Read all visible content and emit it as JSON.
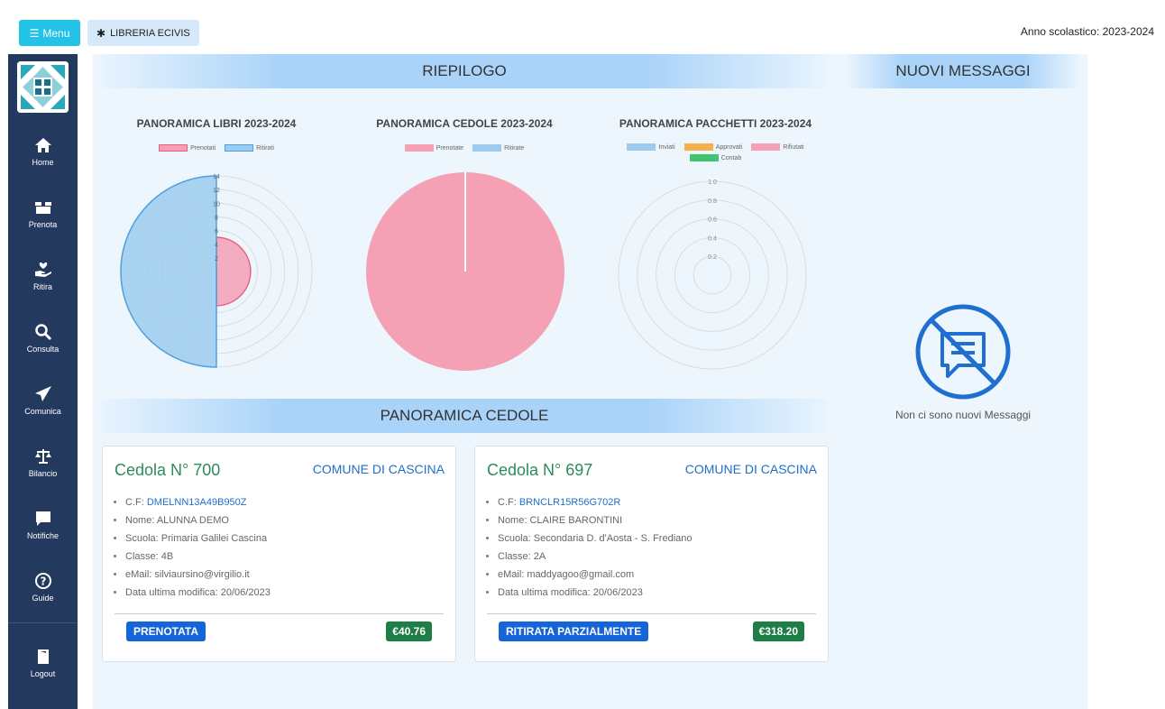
{
  "topbar": {
    "menu_label": "Menu",
    "library_label": "LIBRERIA ECIVIS",
    "school_year": "Anno scolastico: 2023-2024"
  },
  "sidebar": {
    "items": [
      {
        "label": "Home",
        "icon": "home-icon"
      },
      {
        "label": "Prenota",
        "icon": "box-icon"
      },
      {
        "label": "Ritira",
        "icon": "hand-icon"
      },
      {
        "label": "Consulta",
        "icon": "search-icon"
      },
      {
        "label": "Comunica",
        "icon": "paper-plane-icon"
      },
      {
        "label": "Bilancio",
        "icon": "scale-icon"
      },
      {
        "label": "Notifiche",
        "icon": "message-icon"
      },
      {
        "label": "Guide",
        "icon": "question-icon"
      },
      {
        "label": "Logout",
        "icon": "door-icon"
      }
    ]
  },
  "summary": {
    "title": "RIEPILOGO",
    "charts": [
      {
        "title": "PANORAMICA LIBRI 2023-2024",
        "legend": [
          {
            "label": "Prenotati",
            "color": "#f4a0b5"
          },
          {
            "label": "Ritirati",
            "color": "#9ccbef"
          }
        ],
        "ticks": [
          "14",
          "12",
          "10",
          "8",
          "6",
          "4",
          "2"
        ]
      },
      {
        "title": "PANORAMICA CEDOLE 2023-2024",
        "legend": [
          {
            "label": "Prenotate",
            "color": "#f4a0b5"
          },
          {
            "label": "Ritirate",
            "color": "#9ccbef"
          }
        ]
      },
      {
        "title": "PANORAMICA PACCHETTI 2023-2024",
        "legend": [
          {
            "label": "Inviati",
            "color": "#9ccbef"
          },
          {
            "label": "Approvati",
            "color": "#f6b04a"
          },
          {
            "label": "Rifiutati",
            "color": "#f4a0b5"
          },
          {
            "label": "Contab",
            "color": "#3ec56d"
          }
        ],
        "ticks": [
          "1.0",
          "0.8",
          "0.6",
          "0.4",
          "0.2"
        ]
      }
    ]
  },
  "chart_data": [
    {
      "type": "polarArea",
      "title": "PANORAMICA LIBRI 2023-2024",
      "categories": [
        "Prenotati",
        "Ritirati"
      ],
      "values": [
        5,
        14
      ],
      "rlim": [
        0,
        14
      ],
      "colors": [
        "#f4a0b5",
        "#9ccbef"
      ]
    },
    {
      "type": "pie",
      "title": "PANORAMICA CEDOLE 2023-2024",
      "categories": [
        "Prenotate",
        "Ritirate"
      ],
      "values": [
        2,
        0
      ],
      "colors": [
        "#f4a0b5",
        "#9ccbef"
      ]
    },
    {
      "type": "polarArea",
      "title": "PANORAMICA PACCHETTI 2023-2024",
      "categories": [
        "Inviati",
        "Approvati",
        "Rifiutati",
        "Contab"
      ],
      "values": [
        0,
        0,
        0,
        0
      ],
      "rlim": [
        0,
        1.0
      ],
      "colors": [
        "#9ccbef",
        "#f6b04a",
        "#f4a0b5",
        "#3ec56d"
      ]
    }
  ],
  "messages": {
    "title": "NUOVI MESSAGGI",
    "empty_text": "Non ci sono nuovi Messaggi"
  },
  "cedole": {
    "title": "PANORAMICA CEDOLE",
    "cards": [
      {
        "title": "Cedola N° 700",
        "comune": "COMUNE DI CASCINA",
        "cf_label": "C.F: ",
        "cf": "DMELNN13A49B950Z",
        "nome": "Nome: ALUNNA DEMO",
        "scuola": "Scuola: Primaria Galilei Cascina",
        "classe": "Classe: 4B",
        "email": "eMail: silviaursino@virgilio.it",
        "data": "Data ultima modifica: 20/06/2023",
        "status": "PRENOTATA",
        "amount": "€40.76"
      },
      {
        "title": "Cedola N° 697",
        "comune": "COMUNE DI CASCINA",
        "cf_label": "C.F: ",
        "cf": "BRNCLR15R56G702R",
        "nome": "Nome: CLAIRE BARONTINI",
        "scuola": "Scuola: Secondaria D. d'Aosta - S. Frediano",
        "classe": "Classe: 2A",
        "email": "eMail: maddyagoo@gmail.com",
        "data": "Data ultima modifica: 20/06/2023",
        "status": "RITIRATA PARZIALMENTE",
        "amount": "€318.20"
      }
    ]
  }
}
